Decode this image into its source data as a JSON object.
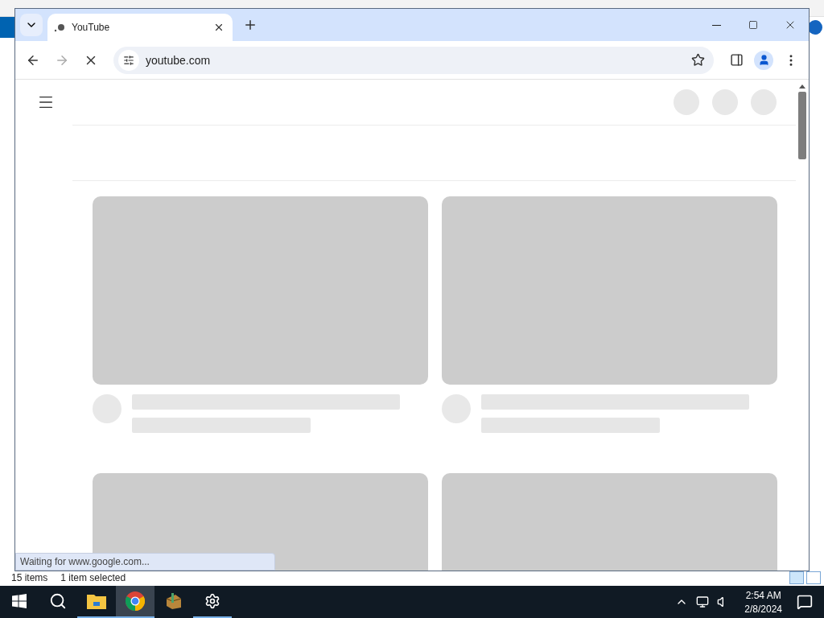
{
  "browser": {
    "tab": {
      "title": "YouTube",
      "selected": true
    },
    "address": "youtube.com",
    "loading": true,
    "status": "Waiting for www.google.com..."
  },
  "page": {
    "cards": [
      {
        "kind": "skeleton"
      },
      {
        "kind": "skeleton"
      },
      {
        "kind": "thumbnail"
      },
      {
        "kind": "thumbnail"
      }
    ]
  },
  "explorer": {
    "item_count": "15 items",
    "selection": "1 item selected"
  },
  "taskbar": {
    "apps": [
      {
        "kind": "explorer",
        "selected": false,
        "running": true
      },
      {
        "kind": "chrome",
        "selected": true,
        "running": true
      },
      {
        "kind": "archive",
        "selected": false,
        "running": false
      },
      {
        "kind": "settings",
        "selected": false,
        "running": true
      }
    ],
    "time": "2:54 AM",
    "date": "2/8/2024"
  }
}
